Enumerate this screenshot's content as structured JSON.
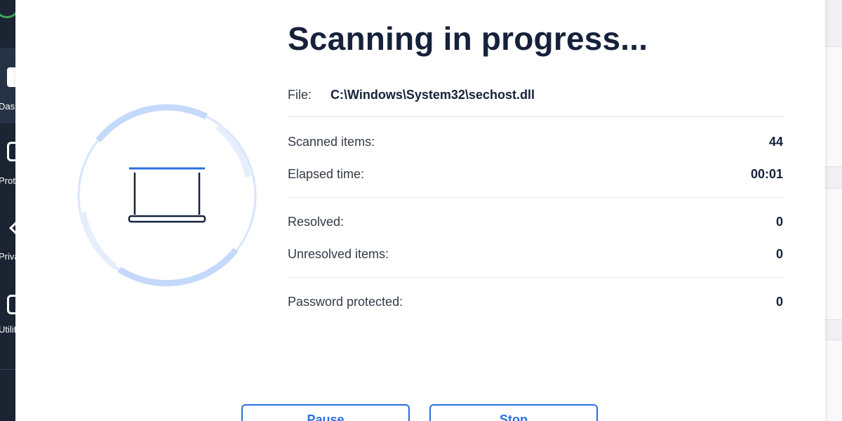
{
  "sidebar": {
    "items": [
      {
        "label": "Dashboard",
        "icon": "dashboard-icon"
      },
      {
        "label": "Protection",
        "icon": "shield-icon"
      },
      {
        "label": "Privacy",
        "icon": "chevron-icon"
      },
      {
        "label": "Utilities",
        "icon": "utilities-icon"
      }
    ]
  },
  "scan": {
    "title": "Scanning in progress...",
    "file_label": "File:",
    "file_path": "C:\\Windows\\System32\\sechost.dll",
    "stats": {
      "scanned_label": "Scanned items:",
      "scanned_value": "44",
      "elapsed_label": "Elapsed time:",
      "elapsed_value": "00:01",
      "resolved_label": "Resolved:",
      "resolved_value": "0",
      "unresolved_label": "Unresolved items:",
      "unresolved_value": "0",
      "password_label": "Password protected:",
      "password_value": "0"
    },
    "icon": "laptop-icon",
    "spinner": "progress-ring"
  },
  "buttons": {
    "pause": "Pause",
    "stop": "Stop"
  },
  "colors": {
    "accent": "#2b6fe0",
    "ring": "#c9dcfb",
    "title": "#16213a",
    "sidebar": "#1b2433"
  }
}
